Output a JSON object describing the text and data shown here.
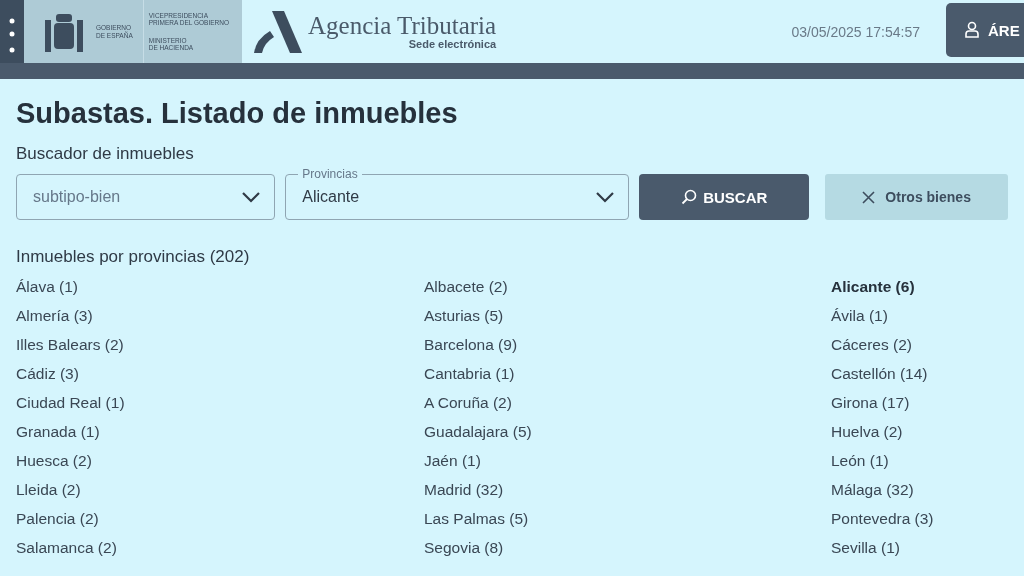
{
  "header": {
    "gov_lines": [
      "GOBIERNO",
      "DE ESPAÑA"
    ],
    "ministry_lines": [
      "VICEPRESIDENCIA",
      "PRIMERA DEL GOBIERNO"
    ],
    "ministry_sub": [
      "MINISTERIO",
      "DE HACIENDA"
    ],
    "brand": "Agencia Tributaria",
    "brand_sub": "Sede electrónica",
    "datetime": "03/05/2025 17:54:57",
    "area_button": "ÁRE"
  },
  "title": "Subastas. Listado de inmuebles",
  "search": {
    "label": "Buscador de inmuebles",
    "subtype": {
      "placeholder": "subtipo-bien"
    },
    "province": {
      "label": "Provincias",
      "value": "Alicante"
    },
    "search_button": "BUSCAR",
    "other_button": "Otros bienes"
  },
  "list_title": "Inmuebles por provincias (202)",
  "provinces": [
    {
      "label": "Álava (1)",
      "selected": false
    },
    {
      "label": "Albacete (2)",
      "selected": false
    },
    {
      "label": "Alicante (6)",
      "selected": true
    },
    {
      "label": "Almería (3)",
      "selected": false
    },
    {
      "label": "Asturias (5)",
      "selected": false
    },
    {
      "label": "Ávila (1)",
      "selected": false
    },
    {
      "label": "Illes Balears (2)",
      "selected": false
    },
    {
      "label": "Barcelona (9)",
      "selected": false
    },
    {
      "label": "Cáceres (2)",
      "selected": false
    },
    {
      "label": "Cádiz (3)",
      "selected": false
    },
    {
      "label": "Cantabria (1)",
      "selected": false
    },
    {
      "label": "Castellón (14)",
      "selected": false
    },
    {
      "label": "Ciudad Real (1)",
      "selected": false
    },
    {
      "label": "A Coruña (2)",
      "selected": false
    },
    {
      "label": "Girona (17)",
      "selected": false
    },
    {
      "label": "Granada (1)",
      "selected": false
    },
    {
      "label": "Guadalajara (5)",
      "selected": false
    },
    {
      "label": "Huelva (2)",
      "selected": false
    },
    {
      "label": "Huesca (2)",
      "selected": false
    },
    {
      "label": "Jaén (1)",
      "selected": false
    },
    {
      "label": "León (1)",
      "selected": false
    },
    {
      "label": "Lleida (2)",
      "selected": false
    },
    {
      "label": "Madrid (32)",
      "selected": false
    },
    {
      "label": "Málaga (32)",
      "selected": false
    },
    {
      "label": "Palencia (2)",
      "selected": false
    },
    {
      "label": "Las Palmas (5)",
      "selected": false
    },
    {
      "label": "Pontevedra (3)",
      "selected": false
    },
    {
      "label": "Salamanca (2)",
      "selected": false
    },
    {
      "label": "Segovia (8)",
      "selected": false
    },
    {
      "label": "Sevilla (1)",
      "selected": false
    }
  ]
}
